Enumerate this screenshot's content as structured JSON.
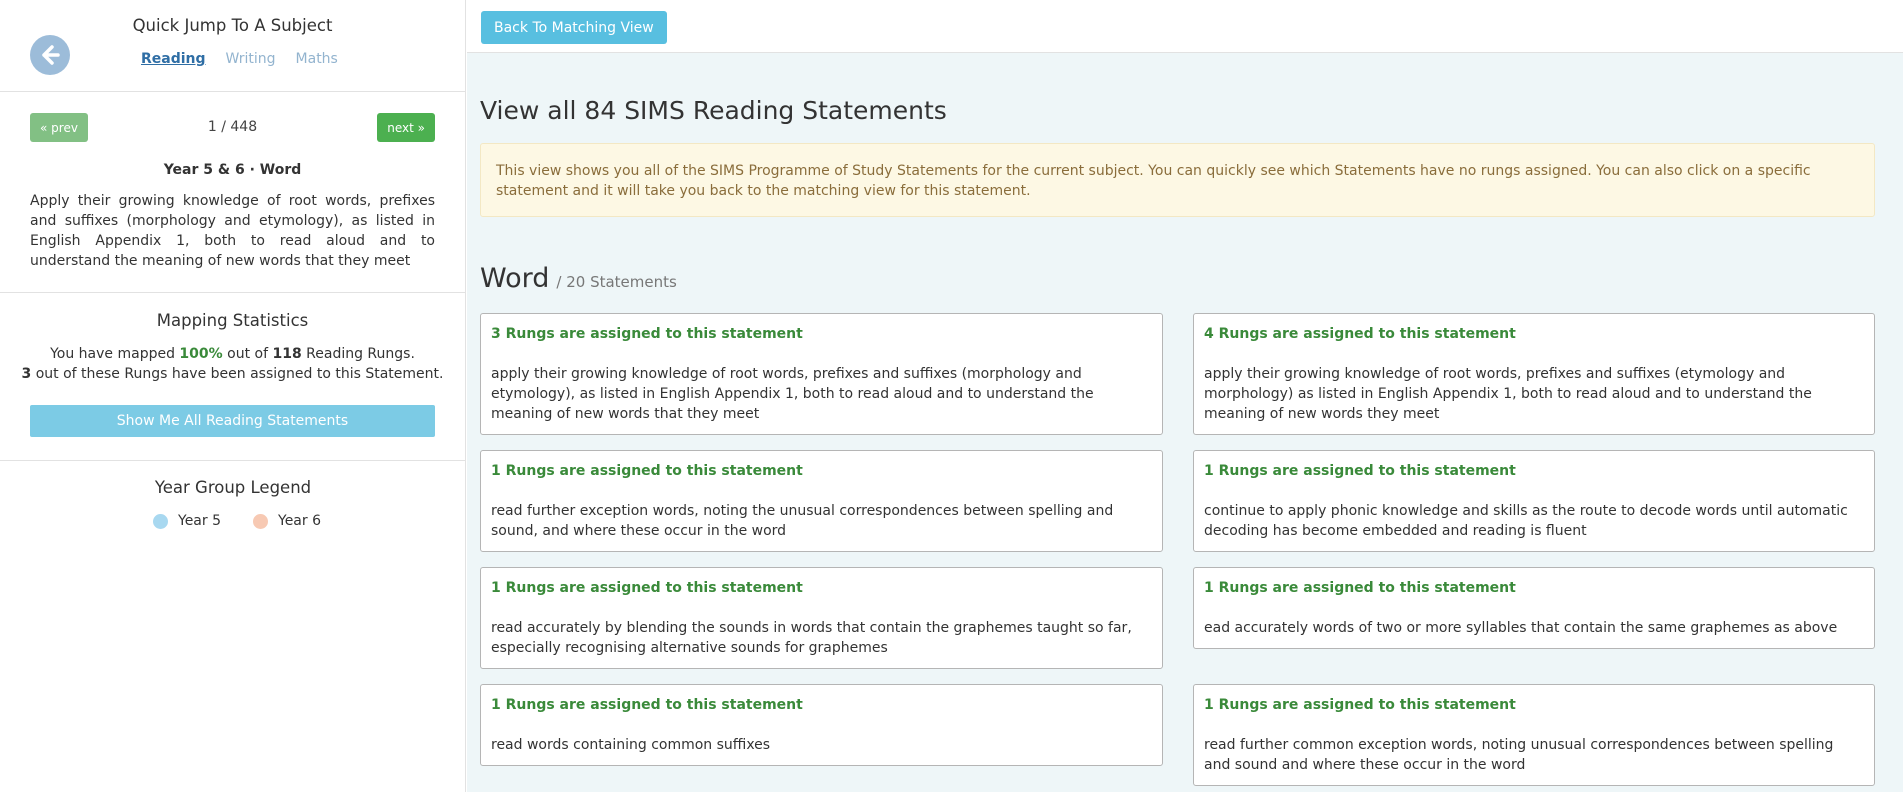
{
  "sidebar": {
    "quick_jump_title": "Quick Jump To A Subject",
    "tabs": [
      {
        "label": "Reading",
        "active": true
      },
      {
        "label": "Writing",
        "active": false
      },
      {
        "label": "Maths",
        "active": false
      }
    ],
    "prev_label": "« prev",
    "next_label": "next »",
    "pager": "1 / 448",
    "statement_heading": "Year 5 & 6 · Word",
    "statement_text": "Apply their growing knowledge of root words, prefixes and suffixes (morphology and etymology), as listed in English Appendix 1, both to read aloud and to understand the meaning of new words that they meet",
    "stats": {
      "title": "Mapping Statistics",
      "line1_pre": "You have mapped ",
      "line1_pct": "100%",
      "line1_mid": " out of ",
      "line1_total": "118",
      "line1_post": " Reading Rungs.",
      "line2_count": "3",
      "line2_post": " out of these Rungs have been assigned to this Statement.",
      "show_button": "Show Me All Reading Statements"
    },
    "legend": {
      "title": "Year Group Legend",
      "items": [
        {
          "label": "Year 5",
          "color": "#a8d8f0"
        },
        {
          "label": "Year 6",
          "color": "#f7c9b3"
        }
      ]
    }
  },
  "main": {
    "back_button": "Back To Matching View",
    "page_title": "View all 84 SIMS Reading Statements",
    "alert_text": "This view shows you all of the SIMS Programme of Study Statements for the current subject. You can quickly see which Statements have no rungs assigned. You can also click on a specific statement and it will take you back to the matching view for this statement.",
    "section_title": "Word",
    "section_count": "/ 20 Statements",
    "cards": [
      {
        "head": "3 Rungs are assigned to this statement",
        "text": "apply their growing knowledge of root words, prefixes and suffixes (morphology and etymology), as listed in English Appendix 1, both to read aloud and to understand the meaning of new words that they meet"
      },
      {
        "head": "4 Rungs are assigned to this statement",
        "text": "apply their growing knowledge of root words, prefixes and suffixes (etymology and morphology) as listed in English Appendix 1, both to read aloud and to understand the meaning of new words they meet"
      },
      {
        "head": "1 Rungs are assigned to this statement",
        "text": "read further exception words, noting the unusual correspondences between spelling and sound, and where these occur in the word"
      },
      {
        "head": "1 Rungs are assigned to this statement",
        "text": "continue to apply phonic knowledge and skills as the route to decode words until automatic decoding has become embedded and reading is fluent"
      },
      {
        "head": "1 Rungs are assigned to this statement",
        "text": "read accurately by blending the sounds in words that contain the graphemes taught so far, especially recognising alternative sounds for graphemes"
      },
      {
        "head": "1 Rungs are assigned to this statement",
        "text": "ead accurately words of two or more syllables that contain the same graphemes as above"
      },
      {
        "head": "1 Rungs are assigned to this statement",
        "text": "read words containing common suffixes"
      },
      {
        "head": "1 Rungs are assigned to this statement",
        "text": "read further common exception words, noting unusual correspondences between spelling and sound and where these occur in the word"
      }
    ]
  }
}
